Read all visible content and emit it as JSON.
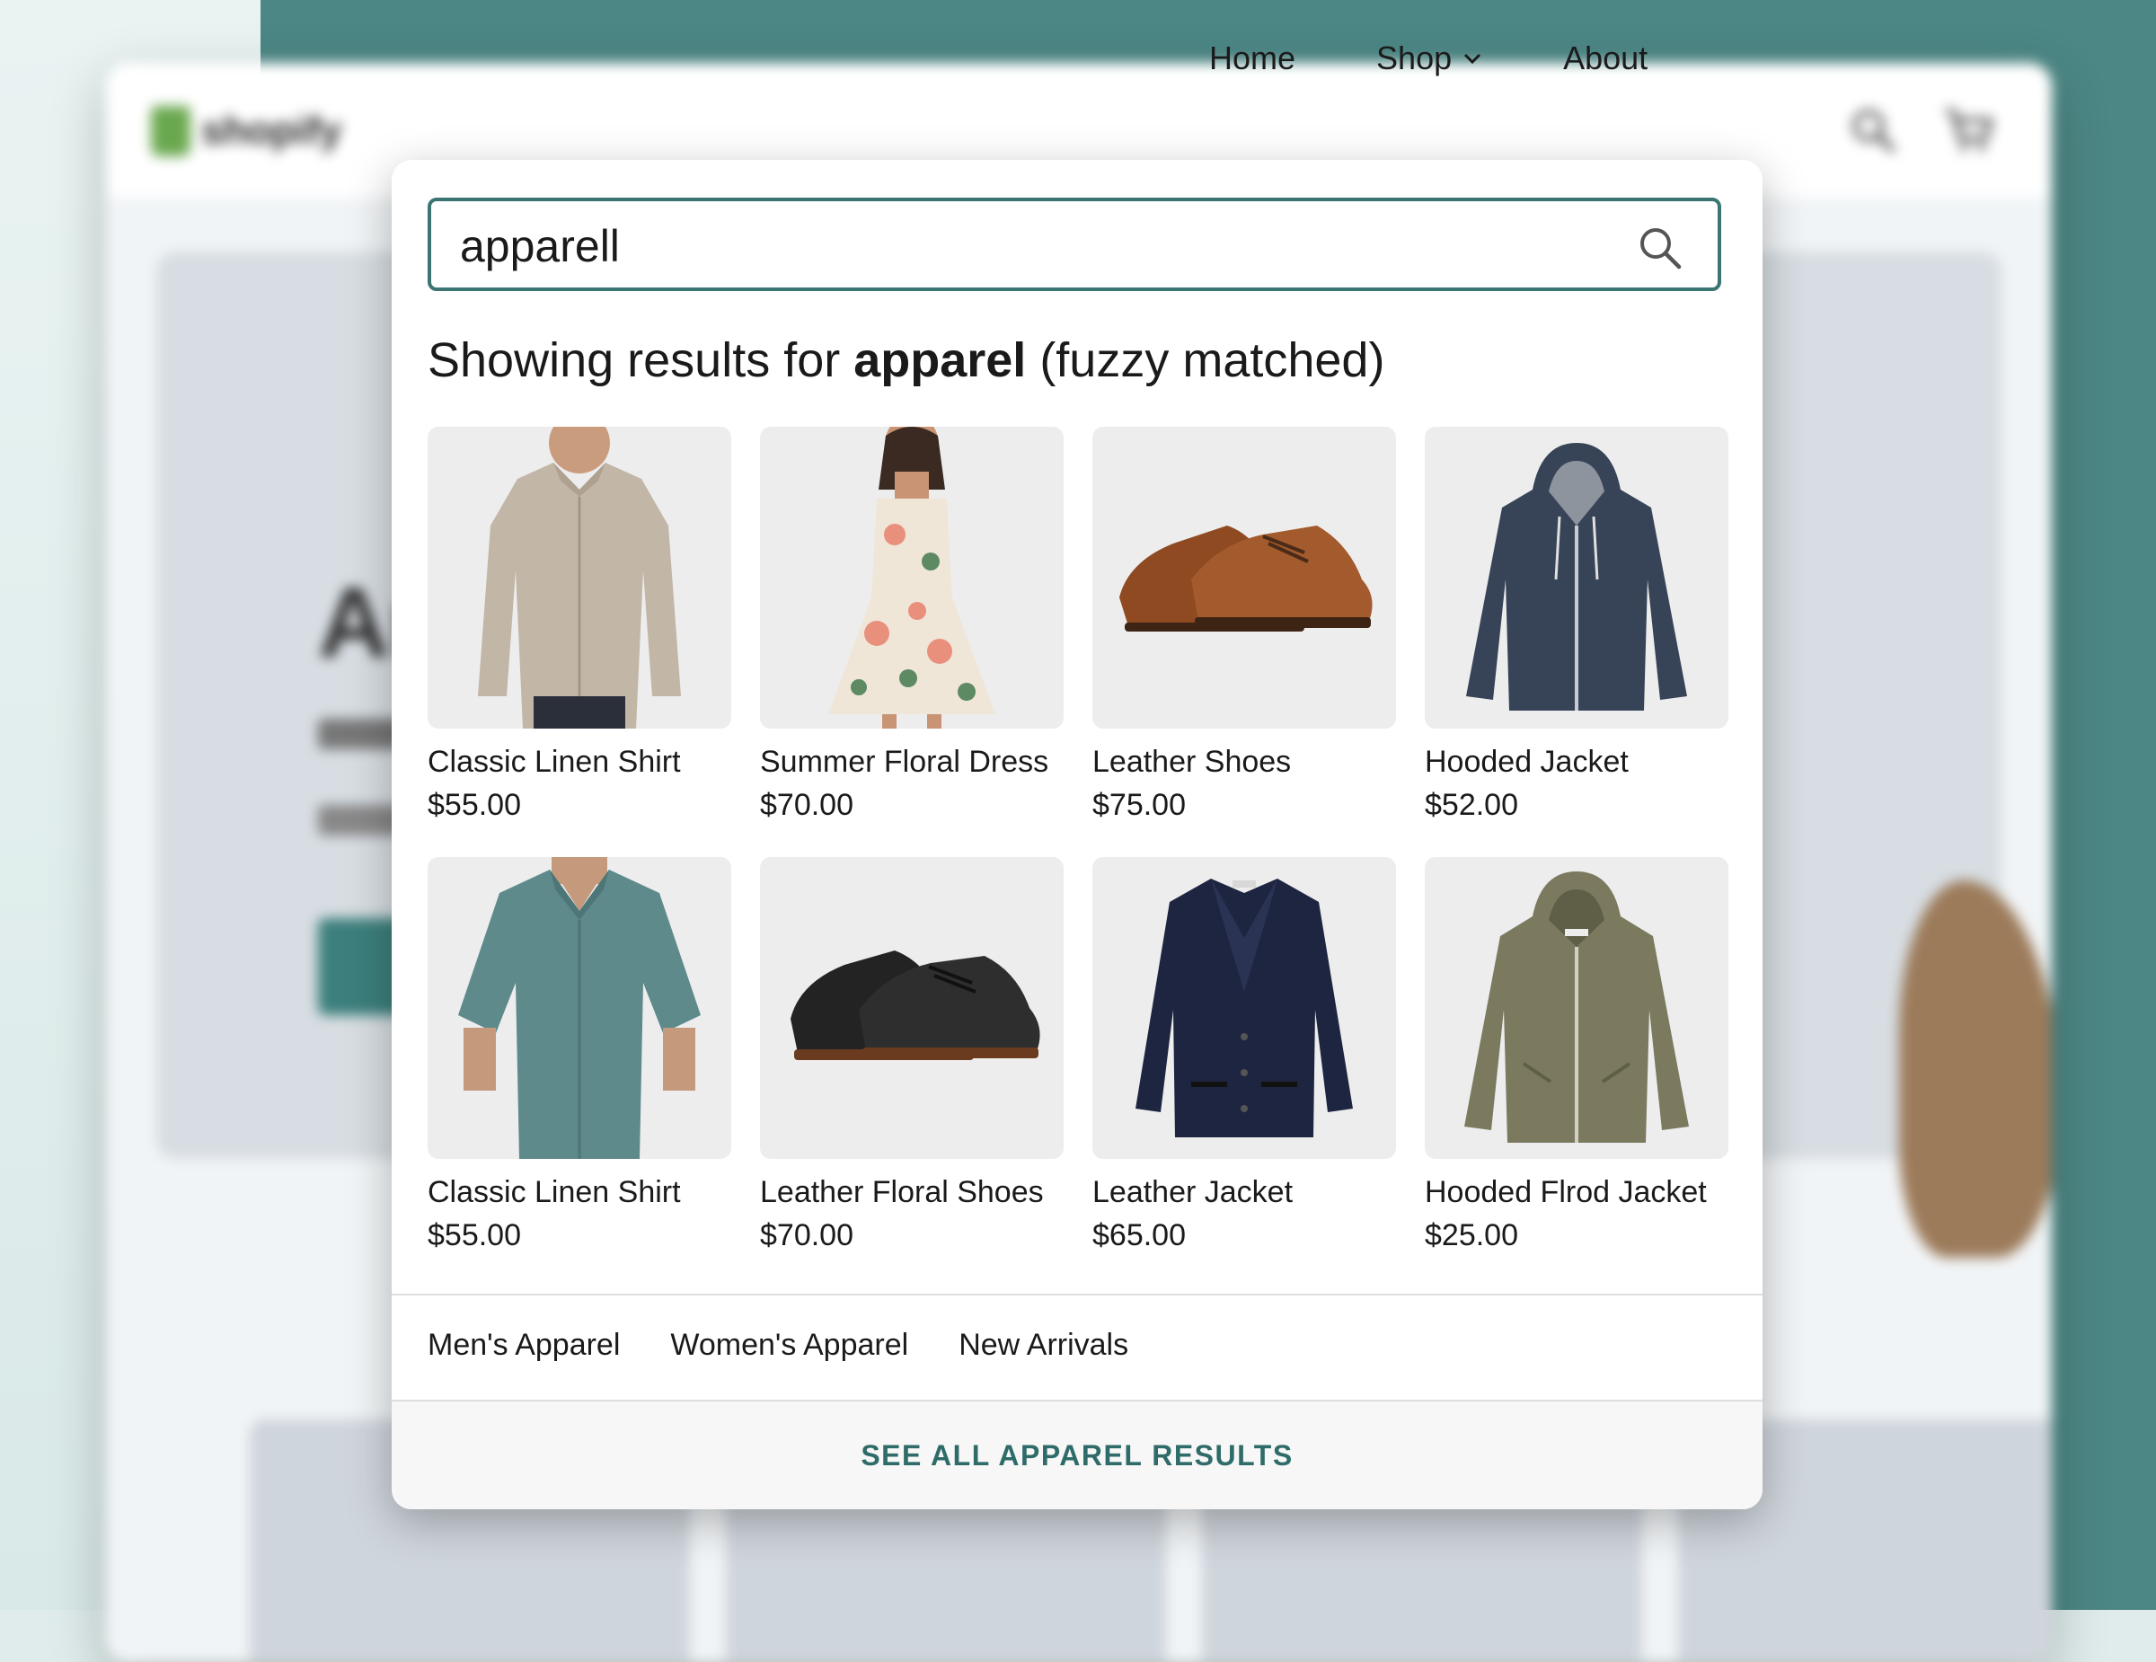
{
  "background": {
    "site": {
      "logo_text": "shopify",
      "nav": {
        "home": "Home",
        "shop": "Shop",
        "about": "About"
      },
      "hero_title": "Ar"
    }
  },
  "search": {
    "query": "apparell",
    "heading_prefix": "Showing results for ",
    "heading_term": "apparel",
    "heading_suffix": " (fuzzy matched)"
  },
  "products": [
    {
      "name": "Classic Linen Shirt",
      "price": "$55.00",
      "icon": "beige-linen-shirt"
    },
    {
      "name": "Summer Floral Dress",
      "price": "$70.00",
      "icon": "floral-dress"
    },
    {
      "name": "Leather Shoes",
      "price": "$75.00",
      "icon": "brown-leather-shoes"
    },
    {
      "name": "Hooded Jacket",
      "price": "$52.00",
      "icon": "navy-hooded-jacket"
    },
    {
      "name": "Classic Linen Shirt",
      "price": "$55.00",
      "icon": "teal-linen-shirt"
    },
    {
      "name": "Leather Floral Shoes",
      "price": "$70.00",
      "icon": "black-leather-shoes"
    },
    {
      "name": "Leather Jacket",
      "price": "$65.00",
      "icon": "navy-coat"
    },
    {
      "name": "Hooded Flrod Jacket",
      "price": "$25.00",
      "icon": "olive-hooded-jacket"
    }
  ],
  "categories": [
    "Men's Apparel",
    "Women's Apparel",
    "New Arrivals"
  ],
  "see_all_label": "SEE ALL APPAREL RESULTS",
  "colors": {
    "accent": "#3b7573",
    "see_all_text": "#2f6c69",
    "backdrop_teal": "#4c8785"
  }
}
